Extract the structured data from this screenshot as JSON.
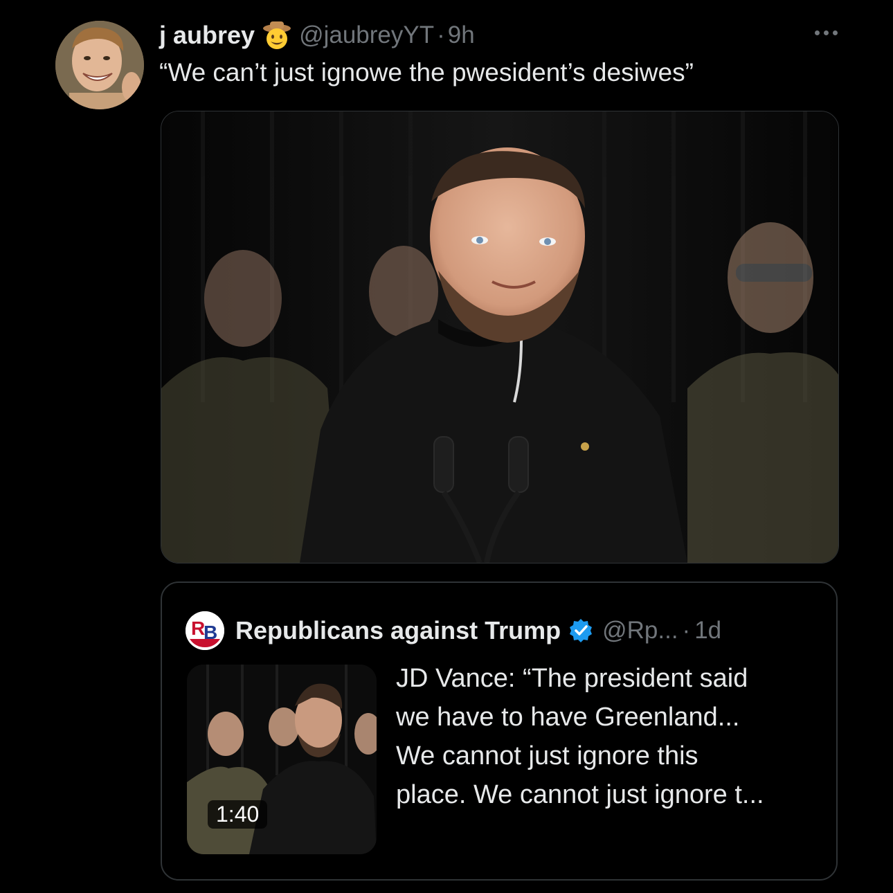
{
  "author": {
    "display_name": "j aubrey",
    "badge_emoji": "cowboy-hat-face-emoji",
    "handle": "@jaubreyYT",
    "separator": "·",
    "time": "9h"
  },
  "more_icon": "more-horizontal-icon",
  "tweet_text": "“We can’t just ignowe the pwesident’s desiwes”",
  "quoted_tweet": {
    "name": "Republicans against Trump",
    "verified_icon": "verified-badge-icon",
    "handle": "@Rp...",
    "separator": "·",
    "time": "1d",
    "video_duration": "1:40",
    "text_lines": [
      "JD Vance: “The president said",
      "we have to have Greenland...",
      "We cannot just ignore this",
      "place. We cannot just ignore t..."
    ]
  },
  "colors": {
    "background": "#000000",
    "primary_text": "#e7e9ea",
    "secondary_text": "#71767b",
    "border": "#2f3336",
    "verified_blue": "#1d9bf0"
  }
}
